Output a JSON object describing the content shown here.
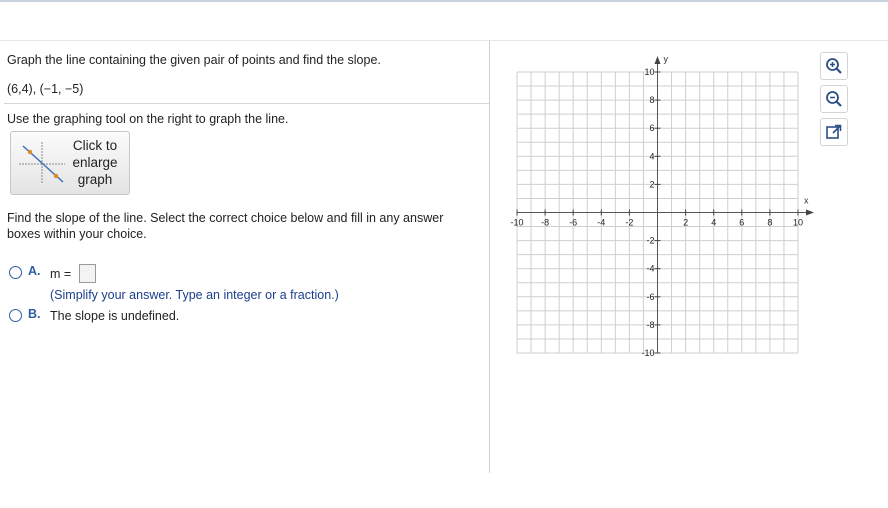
{
  "question": {
    "instruction": "Graph the line containing the given pair of points and find the slope.",
    "points": "(6,4), (−1, −5)",
    "tool_hint": "Use the graphing tool on the right to graph the line.",
    "enlarge_button": [
      "Click to",
      "enlarge",
      "graph"
    ],
    "slope_prompt_line1": "Find the slope of the line. Select the correct choice below and fill in any answer",
    "slope_prompt_line2": "boxes within your choice."
  },
  "choices": [
    {
      "letter": "A.",
      "prefix": "m =",
      "answer_value": "",
      "note": "(Simplify your answer. Type an integer or a fraction.)",
      "selected": false
    },
    {
      "letter": "B.",
      "text": "The slope is undefined.",
      "selected": false
    }
  ],
  "graph": {
    "xlabel": "x",
    "ylabel": "y",
    "xlim": [
      -10,
      10
    ],
    "ylim": [
      -10,
      10
    ],
    "grid": true,
    "x_tick_labels": [
      "-10",
      "-8",
      "-6",
      "-4",
      "-2",
      "2",
      "4",
      "6",
      "8",
      "10"
    ],
    "y_tick_labels": [
      "10",
      "8",
      "6",
      "4",
      "2",
      "-2",
      "-4",
      "-6",
      "-8",
      "-10"
    ]
  },
  "toolbar": [
    {
      "name": "zoom-in-icon"
    },
    {
      "name": "zoom-out-icon"
    },
    {
      "name": "popout-icon"
    }
  ],
  "colors": {
    "accent": "#1b3f8c",
    "radio": "#2f5fa3",
    "grid": "#cfcfcf"
  }
}
